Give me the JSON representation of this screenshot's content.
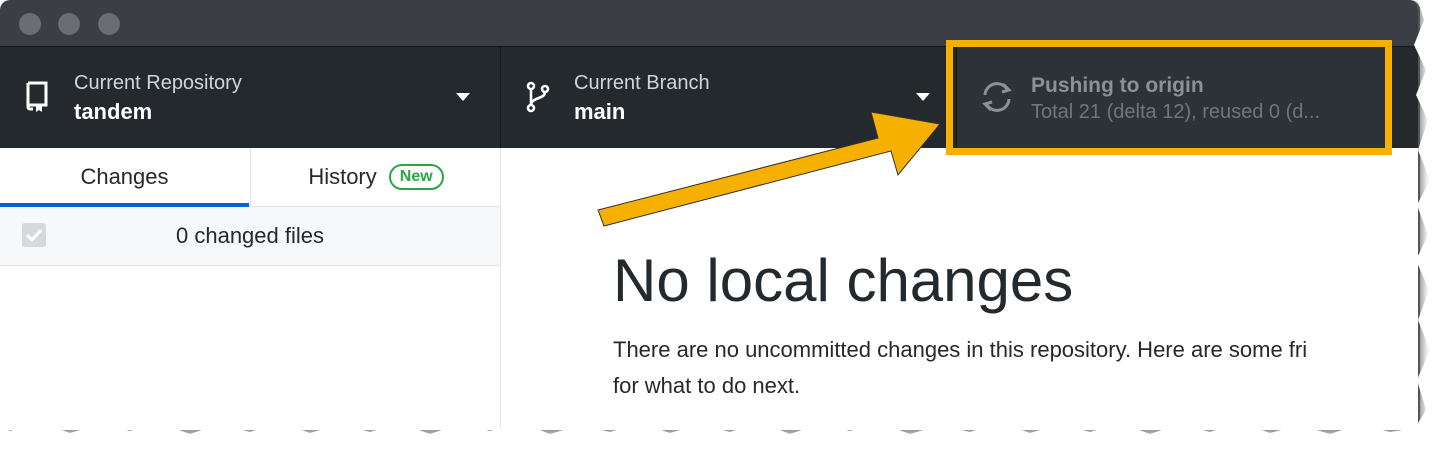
{
  "toolbar": {
    "repository": {
      "title": "Current Repository",
      "value": "tandem"
    },
    "branch": {
      "title": "Current Branch",
      "value": "main"
    },
    "push": {
      "title": "Pushing to origin",
      "description": "Total 21 (delta 12), reused 0 (d..."
    }
  },
  "sidebar": {
    "tabs": [
      {
        "label": "Changes",
        "active": true
      },
      {
        "label": "History",
        "badge": "New"
      }
    ],
    "changed_files_label": "0 changed files"
  },
  "main": {
    "heading": "No local changes",
    "body_line1": "There are no uncommitted changes in this repository. Here are some fri",
    "body_line2": "for what to do next."
  },
  "colors": {
    "toolbar_bg": "#24292e",
    "accent_blue": "#0366d6",
    "badge_green": "#28a745",
    "annotation_yellow": "#f6b000"
  },
  "icons": {
    "repo": "repo-icon",
    "branch": "git-branch-icon",
    "sync": "sync-icon",
    "dropdown": "chevron-down-icon"
  }
}
